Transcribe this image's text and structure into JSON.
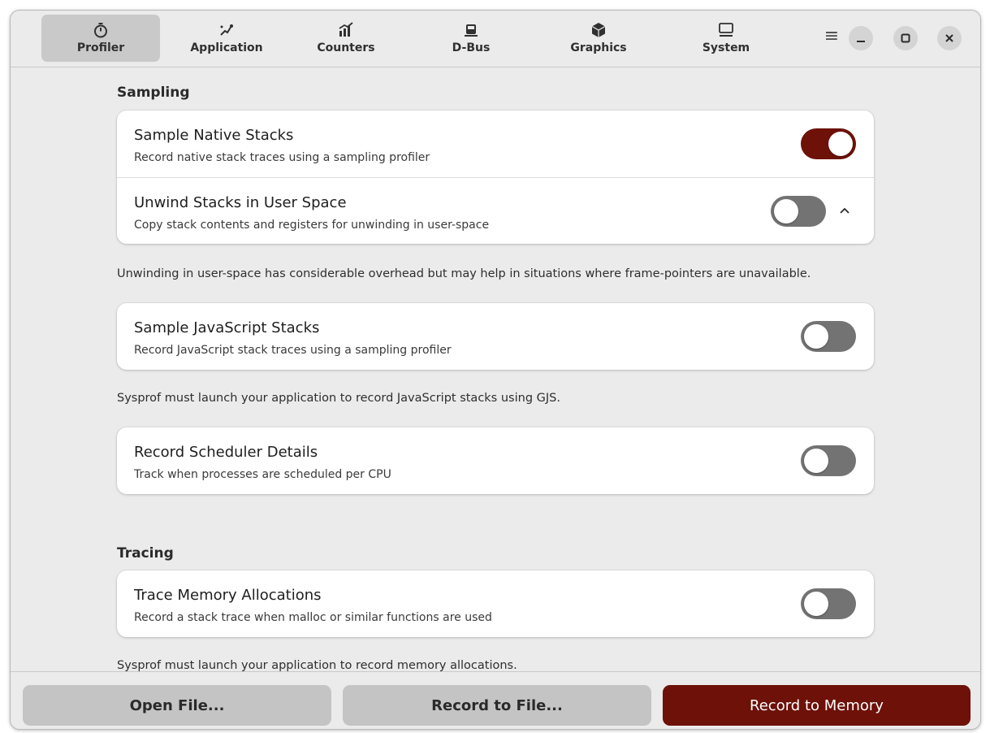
{
  "header": {
    "tabs": [
      {
        "label": "Profiler",
        "icon": "stopwatch-icon",
        "active": true
      },
      {
        "label": "Application",
        "icon": "application-icon",
        "active": false
      },
      {
        "label": "Counters",
        "icon": "counters-chart-icon",
        "active": false
      },
      {
        "label": "D-Bus",
        "icon": "dbus-icon",
        "active": false
      },
      {
        "label": "Graphics",
        "icon": "graphics-cube-icon",
        "active": false
      },
      {
        "label": "System",
        "icon": "monitor-icon",
        "active": false
      }
    ],
    "menu_icon": "≡"
  },
  "sections": {
    "sampling": {
      "title": "Sampling",
      "card1": {
        "native": {
          "title": "Sample Native Stacks",
          "subtitle": "Record native stack traces using a sampling profiler",
          "enabled": true
        },
        "unwind": {
          "title": "Unwind Stacks in User Space",
          "subtitle": "Copy stack contents and registers for unwinding in user-space",
          "enabled": false
        }
      },
      "note1": "Unwinding in user-space has considerable overhead but may help in situations where frame-pointers are unavailable.",
      "js": {
        "title": "Sample JavaScript Stacks",
        "subtitle": "Record JavaScript stack traces using a sampling profiler",
        "enabled": false
      },
      "note2": "Sysprof must launch your application to record JavaScript stacks using GJS.",
      "scheduler": {
        "title": "Record Scheduler Details",
        "subtitle": "Track when processes are scheduled per CPU",
        "enabled": false
      }
    },
    "tracing": {
      "title": "Tracing",
      "memory": {
        "title": "Trace Memory Allocations",
        "subtitle": "Record a stack trace when malloc or similar functions are used",
        "enabled": false
      },
      "note": "Sysprof must launch your application to record memory allocations."
    }
  },
  "footer": {
    "open_file": "Open File...",
    "record_to_file": "Record to File...",
    "record_to_memory": "Record to Memory"
  },
  "colors": {
    "accent": "#6d1109",
    "switch_off": "#737373",
    "background": "#ebebeb"
  }
}
